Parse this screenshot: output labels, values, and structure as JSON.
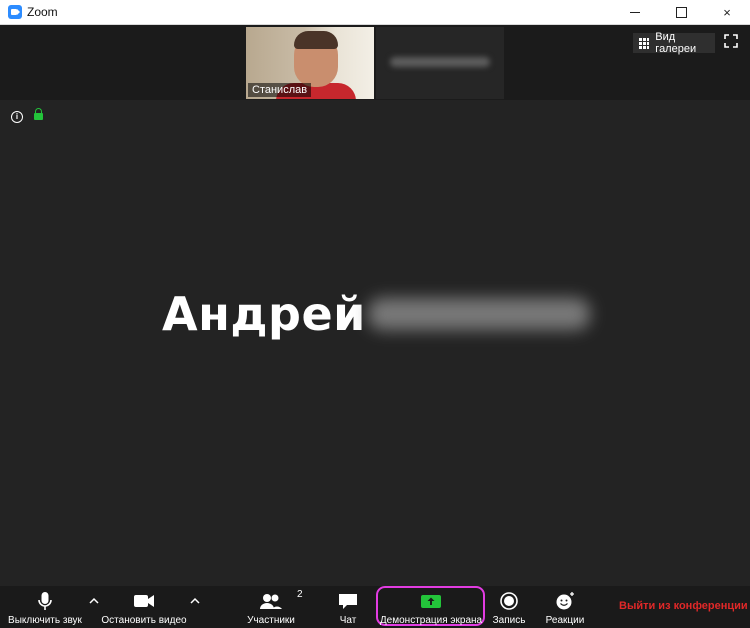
{
  "window": {
    "title": "Zoom",
    "minimize_label": "",
    "maximize_label": "",
    "close_label": "×"
  },
  "top_strip": {
    "self_name": "Станислав",
    "gallery_view_label": "Вид галереи"
  },
  "main": {
    "info_glyph": "i",
    "speaker_first_name": "Андрей"
  },
  "toolbar": {
    "mute_label": "Выключить звук",
    "stop_video_label": "Остановить видео",
    "participants_label": "Участники",
    "participants_count": "2",
    "chat_label": "Чат",
    "share_screen_label": "Демонстрация экрана",
    "record_label": "Запись",
    "reactions_label": "Реакции",
    "leave_label": "Выйти из конференции"
  },
  "colors": {
    "accent_highlight": "#e23ce2",
    "share_green": "#23c43a",
    "leave_red": "#e02828",
    "background": "#232323"
  },
  "icons": [
    "zoom-app-icon",
    "grid-icon",
    "fullscreen-icon",
    "info-icon",
    "lock-icon",
    "microphone-icon",
    "camera-icon",
    "participants-icon",
    "chat-icon",
    "share-screen-icon",
    "record-icon",
    "reactions-icon",
    "chevron-up-icon"
  ]
}
